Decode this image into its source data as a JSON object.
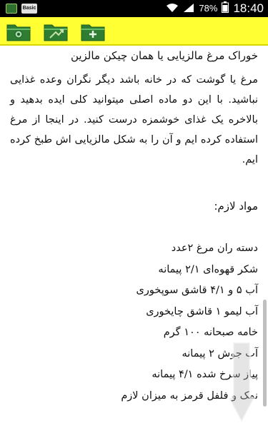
{
  "status_bar": {
    "time": "18:40",
    "battery_percent": "78%",
    "basic_label": "Basic",
    "icons": [
      "app-icon",
      "basic-icon",
      "wifi-icon",
      "signal-icon",
      "battery-icon"
    ]
  },
  "toolbar": {
    "buttons": [
      "folder-back-icon",
      "folder-share-icon",
      "folder-add-icon"
    ],
    "colors": {
      "background": "#ffff33",
      "folder": "#2e7d32"
    }
  },
  "article": {
    "title": "خوراک مرغ مالزیایی یا همان چیکن مالزین",
    "paragraph": "مرغ یا گوشت که در خانه باشد دیگر نگران وعده غذایی نباشید. با این دو ماده اصلی میتوانید کلی ایده بدهید و بالاخره یک غذای خوشمزه درست کنید. در اینجا از مرغ استفاده کرده ایم و آن را به شکل مالزیایی اش طبخ کرده ایم.",
    "ingredients_heading": "مواد لازم:",
    "ingredients": [
      "دسته ران مرغ ۲عدد",
      "شکر قهوه‌ای ۲/۱ پیمانه",
      "آب ۵ و ۴/۱ قاشق سوپخوری",
      "آب لیمو ۱ قاشق چایخوری",
      "خامه صبحانه ۱۰۰ گرم",
      "آب جوش ۲ پیمانه",
      "پیاز سرخ شده ۴/۱ پیمانه",
      "نمک و فلفل قرمز به میزان لازم"
    ]
  }
}
